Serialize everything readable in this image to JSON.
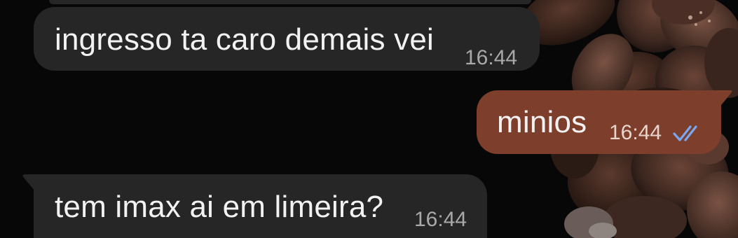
{
  "chat": {
    "messages": [
      {
        "direction": "incoming",
        "text": "ingresso ta caro demais vei",
        "time": "16:44"
      },
      {
        "direction": "outgoing",
        "text": "minios",
        "time": "16:44",
        "status": "read",
        "status_icon": "double-check-icon"
      },
      {
        "direction": "incoming",
        "text": "tem imax ai em limeira?",
        "time": "16:44"
      }
    ]
  },
  "colors": {
    "background": "#070707",
    "incoming_bubble": "#262626",
    "outgoing_bubble": "#7d3f2b",
    "read_check": "#7aa7f0"
  }
}
